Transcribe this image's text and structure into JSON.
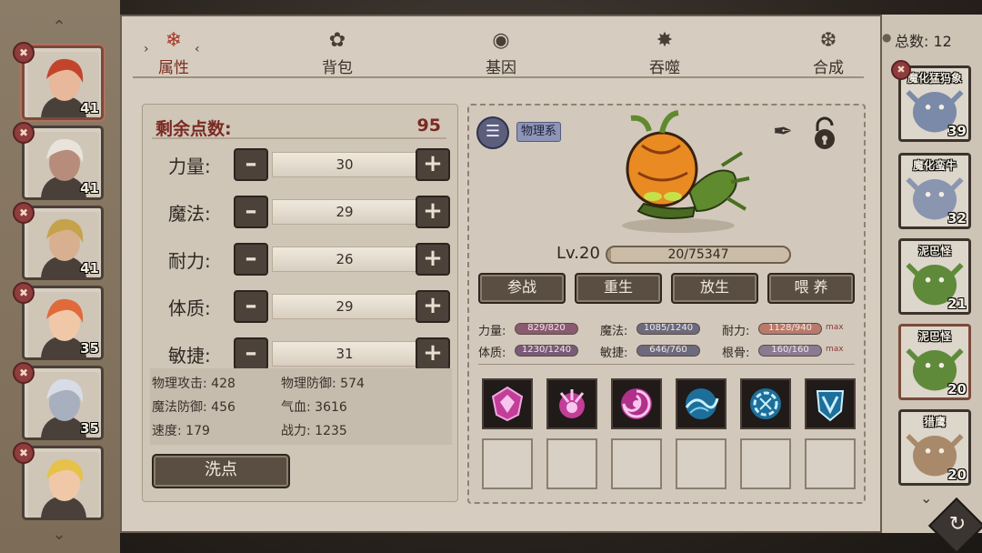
{
  "tabs": [
    {
      "label": "属性",
      "icon": "flame-icon",
      "active": true
    },
    {
      "label": "背包",
      "icon": "bag-icon"
    },
    {
      "label": "基因",
      "icon": "eye-icon"
    },
    {
      "label": "吞噬",
      "icon": "devour-icon"
    },
    {
      "label": "合成",
      "icon": "swirl-icon"
    }
  ],
  "total": {
    "label": "总数: 12"
  },
  "attributes": {
    "remaining_label": "剩余点数:",
    "remaining_value": "95",
    "stats": [
      {
        "label": "力量:",
        "value": "30"
      },
      {
        "label": "魔法:",
        "value": "29"
      },
      {
        "label": "耐力:",
        "value": "26"
      },
      {
        "label": "体质:",
        "value": "29"
      },
      {
        "label": "敏捷:",
        "value": "31"
      }
    ],
    "derived": [
      "物理攻击: 428",
      "物理防御: 574",
      "魔法防御: 456",
      "气血: 3616",
      "速度: 179",
      "战力: 1235"
    ],
    "reset_label": "洗点"
  },
  "pet": {
    "type_badge": "物理系",
    "level_label": "Lv.20",
    "exp_text": "20/75347",
    "exp_fraction": 0.0003,
    "actions": [
      "参战",
      "重生",
      "放生",
      "喂 养"
    ],
    "stats": [
      {
        "label": "力量:",
        "value": "829/820",
        "color": "#8a5a70"
      },
      {
        "label": "魔法:",
        "value": "1085/1240",
        "color": "#6c6a7c"
      },
      {
        "label": "耐力:",
        "value": "1128/940",
        "color": "#b97a6a",
        "max": "max"
      },
      {
        "label": "体质:",
        "value": "1230/1240",
        "color": "#7a5a78"
      },
      {
        "label": "敏捷:",
        "value": "646/760",
        "color": "#6c6a7c"
      },
      {
        "label": "根骨:",
        "value": "160/160",
        "color": "#8c7a92",
        "max": "max"
      }
    ],
    "skills": [
      {
        "icon": "crystal-shield-icon",
        "color": "#d04aa8"
      },
      {
        "icon": "claw-burst-icon",
        "color": "#d04aa8"
      },
      {
        "icon": "vortex-icon",
        "color": "#d04aa8"
      },
      {
        "icon": "wave-icon",
        "color": "#4ab8d8"
      },
      {
        "icon": "rune-circle-icon",
        "color": "#4ab8d8"
      },
      {
        "icon": "shield-mark-icon",
        "color": "#4ab8d8"
      }
    ]
  },
  "heroes": [
    {
      "level": "41",
      "hair": "#c2452b",
      "skin": "#e8b89a",
      "selected": true
    },
    {
      "level": "41",
      "hair": "#e8e4dc",
      "skin": "#b88c7a"
    },
    {
      "level": "41",
      "hair": "#c6a24a",
      "skin": "#d8b090"
    },
    {
      "level": "35",
      "hair": "#e06a3a",
      "skin": "#f0c8a8"
    },
    {
      "level": "35",
      "hair": "#d8dce6",
      "skin": "#a8b0c0"
    },
    {
      "level": "",
      "hair": "#e6c24a",
      "skin": "#f0c8a8"
    }
  ],
  "pet_list": [
    {
      "name": "魔化猛犸象",
      "level": "39",
      "color": "#7a8aa8",
      "badge": true
    },
    {
      "name": "魔化蛮牛",
      "level": "32",
      "color": "#8a96b0"
    },
    {
      "name": "泥巴怪",
      "level": "21",
      "color": "#5e8a3a"
    },
    {
      "name": "泥巴怪",
      "level": "20",
      "color": "#5e8a3a",
      "selected": true
    },
    {
      "name": "猎鹰",
      "level": "20",
      "color": "#a88a6a"
    }
  ]
}
